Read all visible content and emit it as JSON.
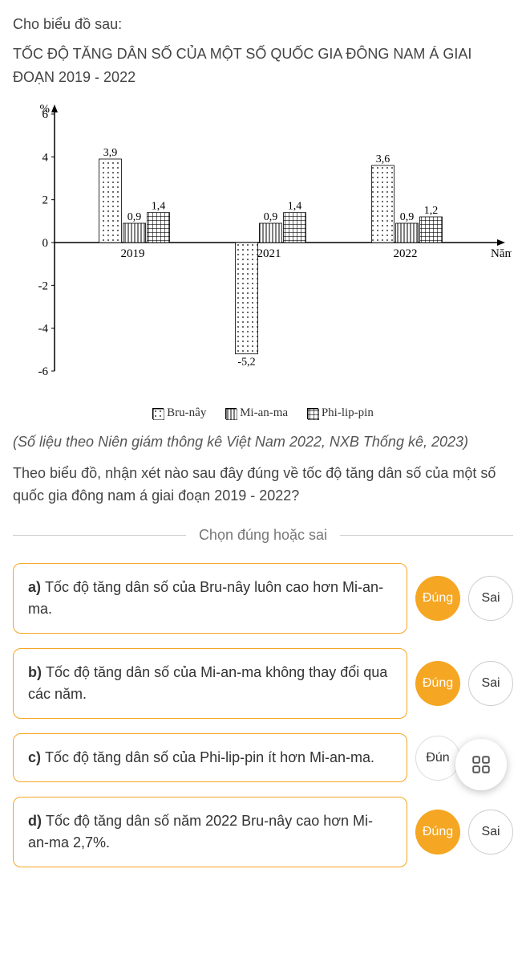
{
  "question": {
    "intro": "Cho biểu đồ sau:",
    "title": "TỐC ĐỘ TĂNG DÂN SỐ CỦA MỘT SỐ QUỐC GIA ĐÔNG NAM Á GIAI ĐOẠN 2019 - 2022",
    "source": "(Số liệu theo Niên giám thông kê Việt Nam 2022, NXB Thống kê, 2023)",
    "followup": "Theo biểu đồ, nhận xét nào sau đây đúng về tốc độ tăng dân số của một số quốc gia đông nam á giai đoạn 2019 - 2022?"
  },
  "chart_data": {
    "type": "bar",
    "title": "TỐC ĐỘ TĂNG DÂN SỐ CỦA MỘT SỐ QUỐC GIA ĐÔNG NAM Á GIAI ĐOẠN 2019 - 2022",
    "categories": [
      "2019",
      "2021",
      "2022"
    ],
    "series": [
      {
        "name": "Bru-nây",
        "values": [
          3.9,
          -5.2,
          3.6
        ]
      },
      {
        "name": "Mi-an-ma",
        "values": [
          0.9,
          0.9,
          0.9
        ]
      },
      {
        "name": "Phi-lip-pin",
        "values": [
          1.4,
          1.4,
          1.2
        ]
      }
    ],
    "xlabel": "Năm",
    "ylabel": "%",
    "ylim": [
      -6,
      6
    ],
    "yticks": [
      -6,
      -4,
      -2,
      0,
      2,
      4,
      6
    ]
  },
  "legend": {
    "s0": "Bru-nây",
    "s1": "Mi-an-ma",
    "s2": "Phi-lip-pin"
  },
  "divider": {
    "label": "Chọn đúng hoặc sai"
  },
  "options": {
    "a_prefix": "a) ",
    "a_text": "Tốc độ tăng dân số của Bru-nây luôn cao hơn Mi-an-ma.",
    "b_prefix": "b) ",
    "b_text": "Tốc độ tăng dân số của Mi-an-ma không thay đổi qua các năm.",
    "c_prefix": "c) ",
    "c_text": "Tốc độ tăng dân số của Phi-lip-pin ít hơn Mi-an-ma.",
    "d_prefix": "d) ",
    "d_text": "Tốc độ tăng dân số năm 2022 Bru-nây cao hơn Mi-an-ma 2,7%."
  },
  "buttons": {
    "true_label": "Đúng",
    "false_label": "Sai",
    "true_trunc": "Đún"
  }
}
